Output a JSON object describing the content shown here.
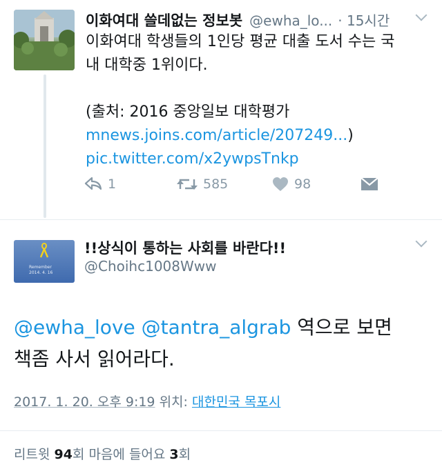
{
  "tweet1": {
    "display_name": "이화여대 쓸데없는 정보봇",
    "handle": "@ewha_lo...",
    "time": "· 15시간",
    "lines": [
      "이화여대 학생들의 1인당 평균 대출 도서 수는 국",
      "내 대학중 1위이다.",
      "",
      "(출처: 2016 중앙일보 대학평가"
    ],
    "link_url": "mnews.joins.com/article/207249...",
    "link_close": ")",
    "pic_link": "pic.twitter.com/x2ywpsTnkp",
    "actions": {
      "reply_count": "1",
      "retweet_count": "585",
      "like_count": "98"
    },
    "icons": {
      "reply": "reply-icon",
      "retweet": "retweet-icon",
      "like": "heart-icon",
      "dm": "envelope-icon",
      "menu": "chevron-down-icon"
    }
  },
  "tweet2": {
    "display_name": "!!상식이 통하는 사회를 바란다!!",
    "handle": "@Choihc1008Www",
    "avatar_text": [
      "Remember",
      "2014. 4. 16"
    ],
    "mention1": "@ewha_love",
    "mention2": "@tantra_algrab",
    "body_line1_rest": " 역으로 보면",
    "body_line2": "책좀 사서 읽어라다.",
    "date": "2017. 1. 20. 오후 9:19",
    "location_label": " 위치: ",
    "location": "대한민국 목포시",
    "stats": {
      "retweet_label": "리트윗 ",
      "retweet_count": "94",
      "retweet_unit": "회",
      "like_label": "  마음에 들어요 ",
      "like_count": "3",
      "like_unit": "회"
    }
  },
  "colors": {
    "link": "#1b95e0",
    "text": "#14171a",
    "muted": "#657786",
    "icon": "#8899a6",
    "divider": "#e6ecf0"
  }
}
